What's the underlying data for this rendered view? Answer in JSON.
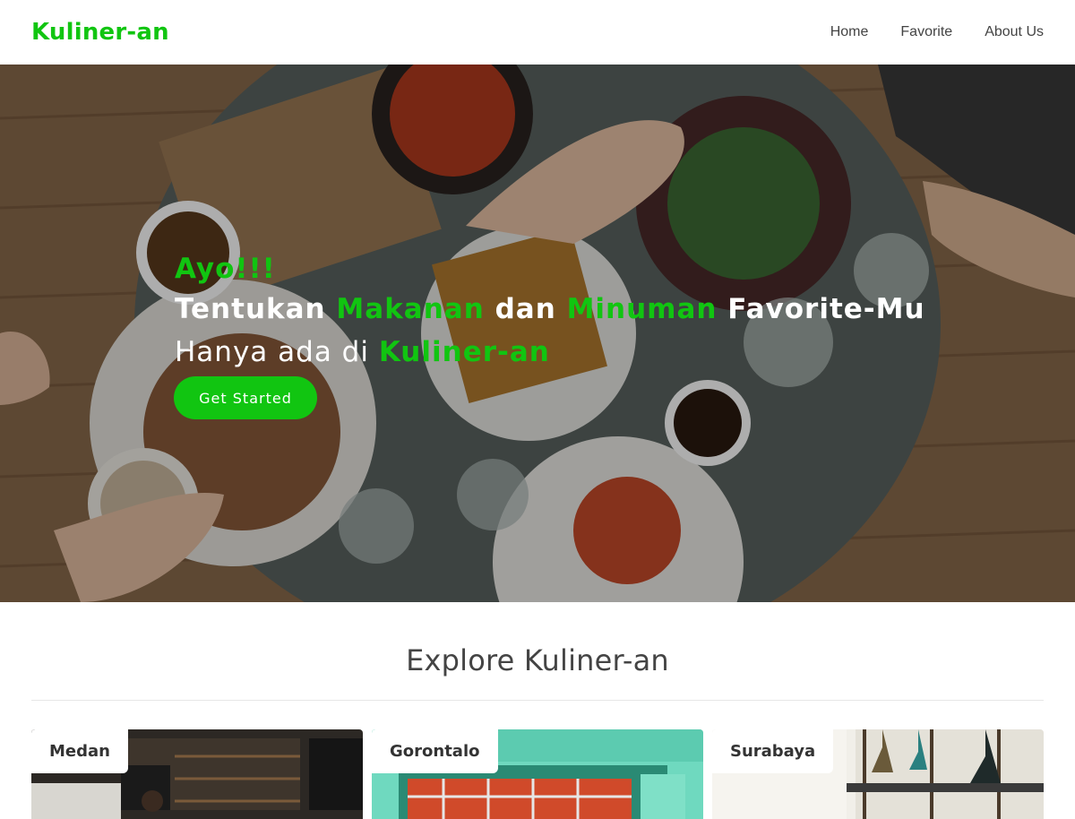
{
  "brand": {
    "name": "Kuliner-an",
    "accent_color": "#11c511"
  },
  "nav": {
    "items": [
      "Home",
      "Favorite",
      "About Us"
    ]
  },
  "hero": {
    "line1": "Ayo!!!",
    "line2": {
      "part1": "Tentukan ",
      "food": "Makanan",
      "part2": " dan ",
      "drink": "Minuman",
      "part3": " Favorite-Mu"
    },
    "line3": {
      "part1": "Hanya ada di ",
      "brand": "Kuliner-an"
    },
    "cta_label": "Get Started"
  },
  "explore": {
    "title": "Explore Kuliner-an",
    "cards": [
      {
        "city": "Medan"
      },
      {
        "city": "Gorontalo"
      },
      {
        "city": "Surabaya"
      }
    ]
  }
}
